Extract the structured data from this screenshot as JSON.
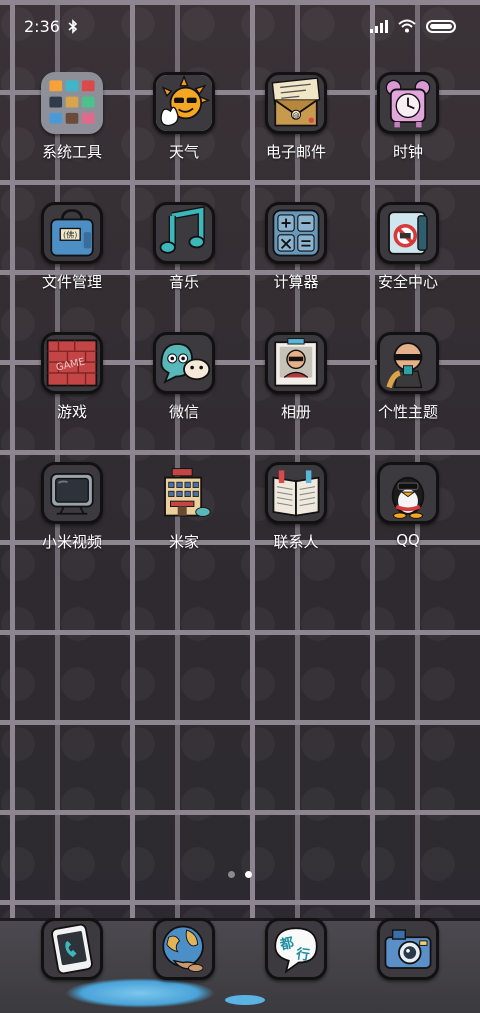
{
  "status_bar": {
    "time": "2:36",
    "bluetooth_icon": "bluetooth-icon",
    "signal_icon": "signal-icon",
    "wifi_icon": "wifi-icon",
    "battery_icon": "battery-icon"
  },
  "apps": [
    {
      "label": "系统工具",
      "icon": "folder-icon"
    },
    {
      "label": "天气",
      "icon": "sun-icon"
    },
    {
      "label": "电子邮件",
      "icon": "envelope-icon"
    },
    {
      "label": "时钟",
      "icon": "alarm-clock-icon"
    },
    {
      "label": "文件管理",
      "icon": "bag-icon"
    },
    {
      "label": "音乐",
      "icon": "music-note-icon"
    },
    {
      "label": "计算器",
      "icon": "calculator-icon"
    },
    {
      "label": "安全中心",
      "icon": "shield-phone-icon"
    },
    {
      "label": "游戏",
      "icon": "game-icon"
    },
    {
      "label": "微信",
      "icon": "chat-icon"
    },
    {
      "label": "相册",
      "icon": "photo-icon"
    },
    {
      "label": "个性主题",
      "icon": "theme-icon"
    },
    {
      "label": "小米视频",
      "icon": "tv-icon"
    },
    {
      "label": "米家",
      "icon": "house-icon"
    },
    {
      "label": "联系人",
      "icon": "contacts-book-icon"
    },
    {
      "label": "QQ",
      "icon": "penguin-icon"
    }
  ],
  "pages": {
    "count": 2,
    "current": 2
  },
  "dock": [
    {
      "icon": "phone-icon"
    },
    {
      "icon": "globe-icon"
    },
    {
      "icon": "speech-bubble-icon",
      "text": "都行"
    },
    {
      "icon": "camera-icon"
    }
  ],
  "colors": {
    "wall": "#3b3439",
    "mortar": "#8d8690",
    "puddle": "#5ab3e3"
  }
}
